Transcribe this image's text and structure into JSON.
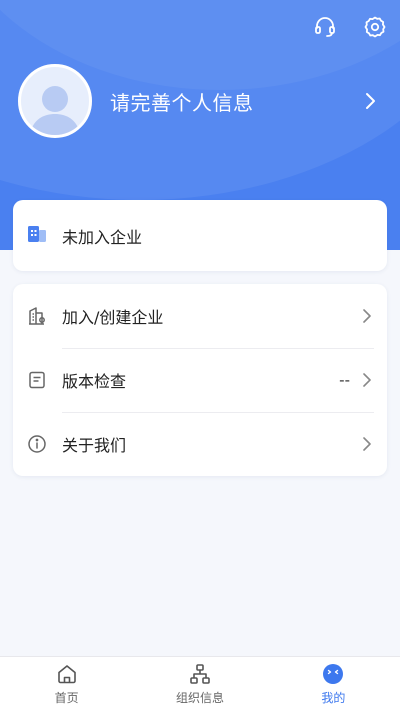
{
  "header": {
    "support_icon": "headset-icon",
    "settings_icon": "gear-icon",
    "profile_prompt": "请完善个人信息"
  },
  "company_card": {
    "icon": "building-icon",
    "label": "未加入企业"
  },
  "menu": [
    {
      "icon": "building-join-icon",
      "label": "加入/创建企业",
      "value": ""
    },
    {
      "icon": "document-icon",
      "label": "版本检查",
      "value": "--"
    },
    {
      "icon": "info-icon",
      "label": "关于我们",
      "value": ""
    }
  ],
  "bottom_nav": [
    {
      "icon": "home-icon",
      "label": "首页",
      "active": false
    },
    {
      "icon": "org-chart-icon",
      "label": "组织信息",
      "active": false
    },
    {
      "icon": "profile-face-icon",
      "label": "我的",
      "active": true
    }
  ],
  "colors": {
    "header_blue": "#4a80f0",
    "accent_blue": "#3d78ee",
    "background": "#f5f7fc"
  }
}
